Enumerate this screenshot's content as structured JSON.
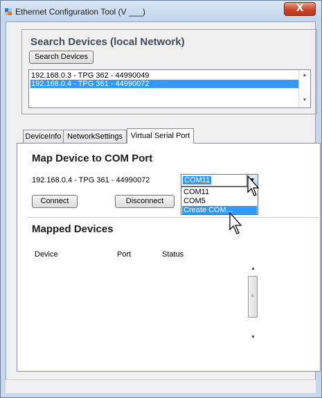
{
  "window": {
    "title": "Ethernet Configuration Tool (V ___)",
    "close_label": "X"
  },
  "search_devices": {
    "title": "Search Devices (local Network)",
    "button_label": "Search Devices",
    "devices": [
      {
        "label": "192.168.0.3 - TPG 362 - 44990049",
        "selected": false
      },
      {
        "label": "192.168.0.4 - TPG 361 - 44990072",
        "selected": true
      }
    ]
  },
  "tabs": [
    {
      "label": "DeviceInfo",
      "active": false
    },
    {
      "label": "NetworkSettings",
      "active": false
    },
    {
      "label": "Virtual Serial Port",
      "active": true
    }
  ],
  "virtual_serial_port": {
    "map_title": "Map Device to COM Port",
    "device_label": "192.168.0.4 - TPG 361 - 44990072",
    "com_selected": "COM11",
    "com_options": [
      "COM11",
      "COM5",
      "Create COM..."
    ],
    "highlighted_option": "Create COM...",
    "connect_label": "Connect",
    "disconnect_label": "Disconnect",
    "mapped_title": "Mapped Devices",
    "columns": [
      "Device",
      "Port",
      "Status"
    ]
  },
  "icons": {
    "app": "app-icon",
    "close": "close-icon",
    "scroll_up": "scroll-up-icon",
    "scroll_down": "scroll-down-icon",
    "dropdown": "chevron-down-icon",
    "cursor": "mouse-pointer-icon"
  }
}
